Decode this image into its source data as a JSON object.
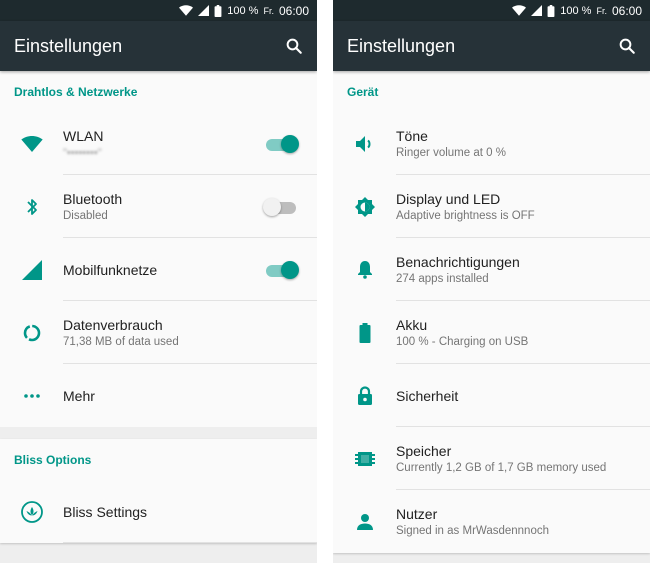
{
  "colors": {
    "accent": "#009688",
    "appbar": "#263238",
    "statusbar": "#1e2a2e"
  },
  "left": {
    "status": {
      "battery": "100 %",
      "day": "Fr.",
      "time": "06:00"
    },
    "title": "Einstellungen",
    "sections": [
      {
        "title": "Drahtlos & Netzwerke",
        "items": [
          {
            "icon": "wifi-icon",
            "title": "WLAN",
            "subtitle": "\"••••••••\"",
            "toggle": "on"
          },
          {
            "icon": "bluetooth-icon",
            "title": "Bluetooth",
            "subtitle": "Disabled",
            "toggle": "off"
          },
          {
            "icon": "signal-icon",
            "title": "Mobilfunknetze",
            "toggle": "on"
          },
          {
            "icon": "data-usage-icon",
            "title": "Datenverbrauch",
            "subtitle": "71,38 MB of data used"
          },
          {
            "icon": "more-icon",
            "title": "Mehr"
          }
        ]
      },
      {
        "title": "Bliss Options",
        "items": [
          {
            "icon": "bliss-lotus-icon",
            "title": "Bliss Settings"
          }
        ]
      }
    ]
  },
  "right": {
    "status": {
      "battery": "100 %",
      "day": "Fr.",
      "time": "06:00"
    },
    "title": "Einstellungen",
    "sections": [
      {
        "title": "Gerät",
        "items": [
          {
            "icon": "volume-icon",
            "title": "Töne",
            "subtitle": "Ringer volume at 0 %"
          },
          {
            "icon": "brightness-icon",
            "title": "Display und LED",
            "subtitle": "Adaptive brightness is OFF"
          },
          {
            "icon": "bell-icon",
            "title": "Benachrichtigungen",
            "subtitle": "274 apps installed"
          },
          {
            "icon": "battery-icon",
            "title": "Akku",
            "subtitle": "100 % - Charging on USB"
          },
          {
            "icon": "lock-icon",
            "title": "Sicherheit"
          },
          {
            "icon": "storage-icon",
            "title": "Speicher",
            "subtitle": "Currently 1,2 GB of 1,7 GB memory used"
          },
          {
            "icon": "user-icon",
            "title": "Nutzer",
            "subtitle": "Signed in as MrWasdennnoch"
          }
        ]
      }
    ]
  }
}
